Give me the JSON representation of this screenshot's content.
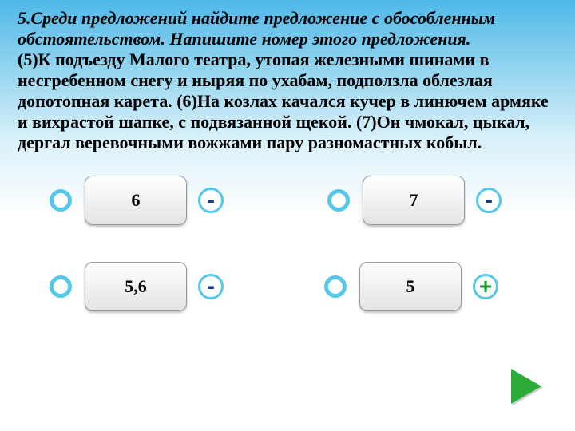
{
  "question": {
    "num": "5.",
    "prompt": "Среди предложений найдите предложение с обособленным обстоятельством. Напишите номер этого предложения.",
    "body": "(5)К подъезду Малого театра, утопая железными шинами в несгребенном снегу и ныряя по ухабам, подползла облезлая допотопная карета. (6)На козлах качался кучер в линючем армяке и вихрастой шапке, с подвязанной щекой. (7)Он чмокал, цыкал, дергал веревочными вожжами пару разномастных кобыл."
  },
  "options": {
    "a": {
      "label": "6",
      "mark": "-"
    },
    "b": {
      "label": "7",
      "mark": "-"
    },
    "c": {
      "label": "5,6",
      "mark": "-"
    },
    "d": {
      "label": "5",
      "mark": "+"
    }
  },
  "correct": "d",
  "nextLabel": "Next"
}
